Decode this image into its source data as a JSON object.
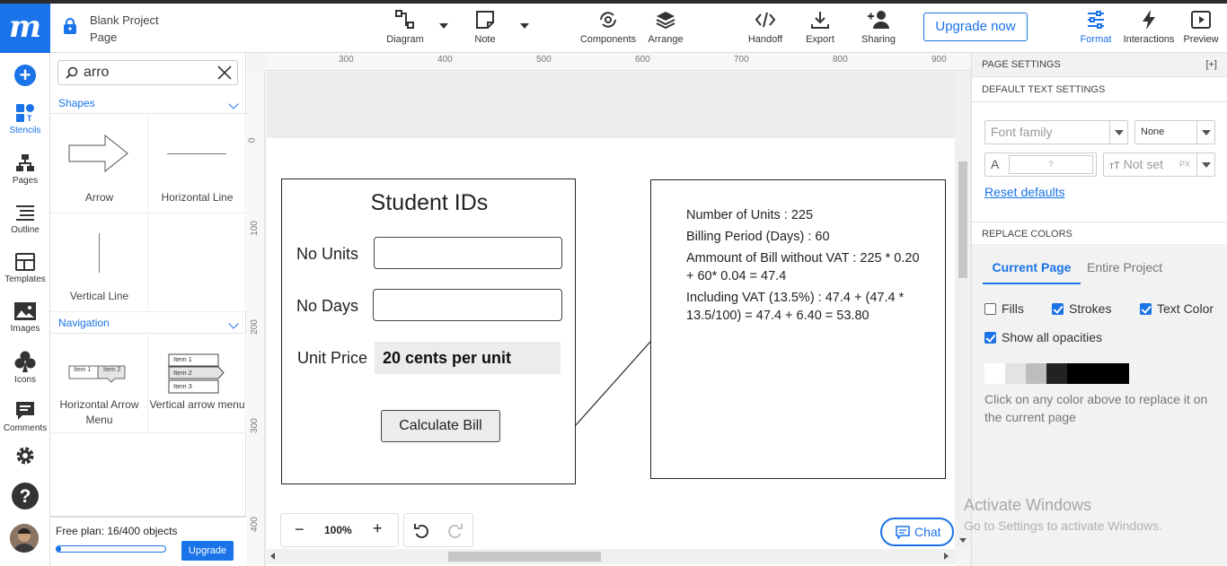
{
  "app": {
    "logo": "m",
    "project_name_line1": "Blank Project",
    "project_name_line2": "Page"
  },
  "toolbar": {
    "diagram": "Diagram",
    "note": "Note",
    "components": "Components",
    "arrange": "Arrange",
    "handoff": "Handoff",
    "export": "Export",
    "sharing": "Sharing",
    "upgrade": "Upgrade now",
    "format": "Format",
    "interactions": "Interactions",
    "preview": "Preview"
  },
  "leftnav": {
    "stencils": "Stencils",
    "pages": "Pages",
    "outline": "Outline",
    "templates": "Templates",
    "images": "Images",
    "icons": "Icons",
    "comments": "Comments"
  },
  "stencils": {
    "search_value": "arro",
    "shapes_section": "Shapes",
    "navigation_section": "Navigation",
    "items": {
      "arrow": "Arrow",
      "hline": "Horizontal Line",
      "vline": "Vertical Line",
      "harrow_menu": "Horizontal Arrow Menu",
      "varrow_menu": "Vertical arrow menu"
    },
    "menu_item1": "Item 1",
    "menu_item2": "Item 2",
    "menu_item3": "Item 3",
    "free_plan": "Free plan: 16/400 objects",
    "plan_progress": 0.04,
    "upgrade": "Upgrade"
  },
  "rulers": {
    "h": [
      "300",
      "400",
      "500",
      "600",
      "700",
      "800",
      "900"
    ],
    "v": [
      "0",
      "100",
      "200",
      "300",
      "400"
    ]
  },
  "canvas": {
    "form": {
      "title": "Student IDs",
      "units_label": "No Units",
      "days_label": "No Days",
      "price_label": "Unit Price",
      "price_value": "20 cents per unit",
      "calc_button": "Calculate Bill"
    },
    "info": {
      "line1": "Number of Units : 225",
      "line2": "Billing Period (Days) : 60",
      "line3": "Ammount of Bill without VAT : 225 * 0.20 + 60* 0.04 = 47.4",
      "line4": "Including VAT (13.5%) : 47.4 + (47.4 * 13.5/100) = 47.4 + 6.40 = 53.80"
    },
    "zoom": "100%",
    "chat": "Chat"
  },
  "rightpanel": {
    "page_settings": "PAGE SETTINGS",
    "expand": "[+]",
    "default_text": "DEFAULT TEXT SETTINGS",
    "font_family": "Font family",
    "font_none": "None",
    "size_a": "A",
    "size_q": "?",
    "not_set": "Not set",
    "px": "PX",
    "reset": "Reset defaults",
    "replace_colors": "REPLACE COLORS",
    "tab_current": "Current Page",
    "tab_entire": "Entire Project",
    "fills": "Fills",
    "strokes": "Strokes",
    "text_color": "Text Color",
    "show_opacities": "Show all opacities",
    "swatches": [
      "#ffffff",
      "#e3e3e3",
      "#bdbdbd",
      "#222222",
      "#000000",
      "#000000",
      "#000000"
    ],
    "hint": "Click on any color above to replace it on the current page"
  },
  "watermark": {
    "line1": "Activate Windows",
    "line2": "Go to Settings to activate Windows."
  },
  "colors": {
    "accent": "#1a73e8"
  }
}
